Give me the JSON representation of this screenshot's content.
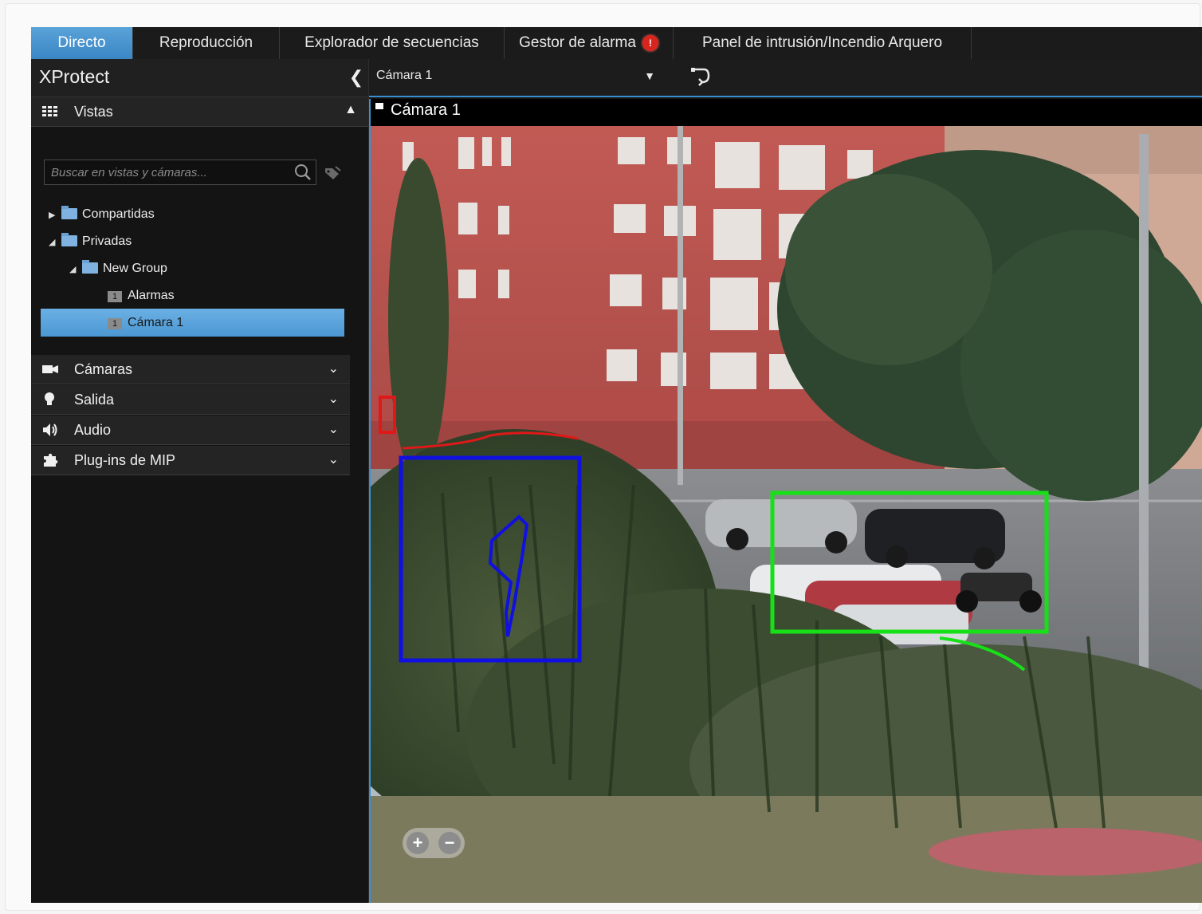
{
  "tabs": [
    {
      "label": "Directo",
      "active": true
    },
    {
      "label": "Reproducción",
      "active": false
    },
    {
      "label": "Explorador de secuencias",
      "active": false
    },
    {
      "label": "Gestor de alarma",
      "active": false,
      "badge_icon": "alarm-badge-icon"
    },
    {
      "label": "Panel de intrusión/Incendio Arquero",
      "active": false
    }
  ],
  "sidebar": {
    "title": "XProtect",
    "views_panel": {
      "label": "Vistas",
      "search_placeholder": "Buscar en vistas y cámaras...",
      "tree": [
        {
          "label": "Compartidas",
          "type": "folder",
          "expanded": false
        },
        {
          "label": "Privadas",
          "type": "folder",
          "expanded": true
        },
        {
          "label": "New Group",
          "type": "folder",
          "expanded": true
        },
        {
          "label": "Alarmas",
          "type": "view",
          "badge": "1"
        },
        {
          "label": "Cámara 1",
          "type": "view",
          "badge": "1",
          "selected": true
        }
      ]
    },
    "panels": [
      {
        "label": "Cámaras",
        "icon": "camera-icon"
      },
      {
        "label": "Salida",
        "icon": "lightbulb-icon"
      },
      {
        "label": "Audio",
        "icon": "speaker-icon"
      },
      {
        "label": "Plug-ins de MIP",
        "icon": "puzzle-icon"
      }
    ]
  },
  "viewbar": {
    "selected_view": "Cámara 1"
  },
  "camera": {
    "title": "Cámara 1"
  },
  "colors": {
    "accent": "#3a8fd1",
    "selection": "#5aa3d8",
    "alarm": "#d8261e"
  }
}
